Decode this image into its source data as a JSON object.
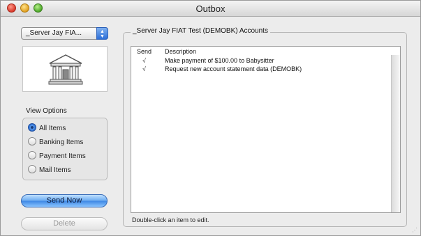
{
  "window": {
    "title": "Outbox"
  },
  "sidebar": {
    "account_popup": "_Server Jay FIA...",
    "view_options": {
      "label": "View Options",
      "items": [
        {
          "label": "All Items",
          "selected": true
        },
        {
          "label": "Banking Items",
          "selected": false
        },
        {
          "label": "Payment Items",
          "selected": false
        },
        {
          "label": "Mail Items",
          "selected": false
        }
      ]
    },
    "send_now": "Send Now",
    "delete": "Delete"
  },
  "main": {
    "group_title": "_Server Jay FIAT Test (DEMOBK) Accounts",
    "columns": {
      "send": "Send",
      "description": "Description"
    },
    "rows": [
      {
        "send": "√",
        "description": "Make payment of $100.00 to Babysitter"
      },
      {
        "send": "√",
        "description": "Request new account statement data (DEMOBK)"
      }
    ],
    "hint": "Double-click an item to edit."
  },
  "icons": {
    "window_close": "close-icon",
    "window_minimize": "minimize-icon",
    "window_zoom": "zoom-icon",
    "popup_arrows": "updown-arrows-icon",
    "bank": "bank-building-icon",
    "checkmark": "checkmark-icon"
  },
  "colors": {
    "accent": "#3c86e4",
    "window_bg": "#ececec"
  }
}
